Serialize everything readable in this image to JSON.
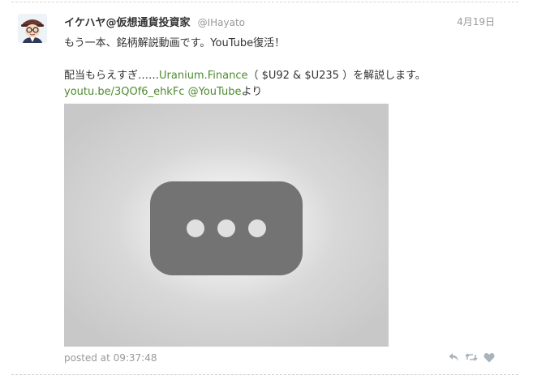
{
  "tweet": {
    "author": {
      "display_name": "イケハヤ@仮想通貨投資家",
      "screen_name": "@IHayato"
    },
    "date": "4月19日",
    "lines": {
      "line1": "もう一本、銘柄解説動画です。YouTube復活！",
      "line2_prefix": "配当もらえすぎ……",
      "line2_link": "Uranium.Finance",
      "line2_suffix": "（ $U92 & $U235 ）を解説します。",
      "line3_link1": "youtu.be/3QOf6_ehkFc",
      "line3_space": " ",
      "line3_link2": "@YouTube",
      "line3_suffix": "より"
    },
    "media": {
      "state": "loading",
      "icon": "more-dots-icon"
    },
    "posted_at": "posted at 09:37:48",
    "actions": {
      "reply_icon": "reply-icon",
      "retweet_icon": "retweet-icon",
      "like_icon": "heart-icon"
    }
  },
  "colors": {
    "link": "#4e8a2f",
    "text": "#333333",
    "muted": "#999999",
    "action_icon": "#a8b3bd"
  }
}
